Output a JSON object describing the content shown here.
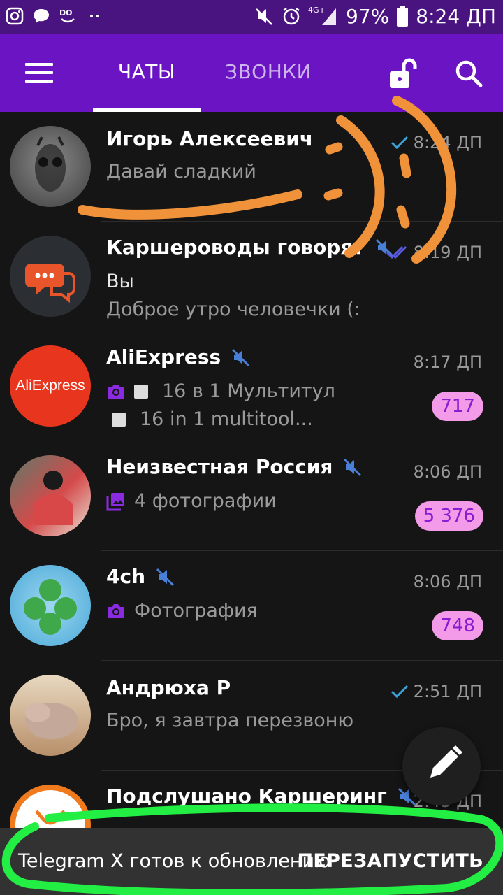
{
  "status_bar": {
    "battery": "97%",
    "time": "8:24 ДП",
    "network": "4G+",
    "icons": [
      "instagram-icon",
      "chat-bubble-icon",
      "app-badge-icon",
      "dots-icon",
      "mute-icon",
      "alarm-icon",
      "signal-icon",
      "battery-icon"
    ]
  },
  "header": {
    "tabs": [
      {
        "label": "ЧАТЫ",
        "active": true
      },
      {
        "label": "ЗВОНКИ",
        "active": false
      }
    ]
  },
  "chats": [
    {
      "name": "Игорь Алексеевич",
      "preview": "Давай сладкий",
      "time": "8:24 ДП",
      "read_status": "sent",
      "muted": false
    },
    {
      "name": "Каршероводы говорят",
      "sender": "Вы",
      "preview": "Доброе утро человечки (:",
      "time": "8:19 ДП",
      "read_status": "read",
      "muted": true
    },
    {
      "name": "AliExpress",
      "preview_line1": "16 в 1 Мультитул",
      "preview_line2": "16 in 1 multitool...",
      "time": "8:17 ДП",
      "badge": "717",
      "muted": true,
      "avatar_text": "AliExpress"
    },
    {
      "name": "Неизвестная Россия",
      "preview": "4 фотографии",
      "time": "8:06 ДП",
      "badge": "5 376",
      "muted": true
    },
    {
      "name": "4ch",
      "preview": "Фотография",
      "time": "8:06 ДП",
      "badge": "748",
      "muted": true
    },
    {
      "name": "Андрюха Р",
      "preview": "Бро, я завтра перезвоню",
      "time": "2:51 ДП",
      "read_status": "sent",
      "muted": false
    },
    {
      "name": "Подслушано Каршеринг",
      "preview": "",
      "time": "2:43 ДП",
      "muted": true
    }
  ],
  "snackbar": {
    "message": "Telegram X готов к обновлению",
    "action": "ПЕРЕЗАПУСТИТЬ"
  },
  "colors": {
    "status_bar": "#4a1480",
    "app_bar": "#6a14c4",
    "background": "#151515",
    "badge_bg": "#f39be9",
    "badge_text": "#8a1bd0",
    "accent_icons": "#8a2be2",
    "mute_icon": "#4a7fd6",
    "annotation_orange": "#f0923a",
    "annotation_green": "#22ee44"
  }
}
